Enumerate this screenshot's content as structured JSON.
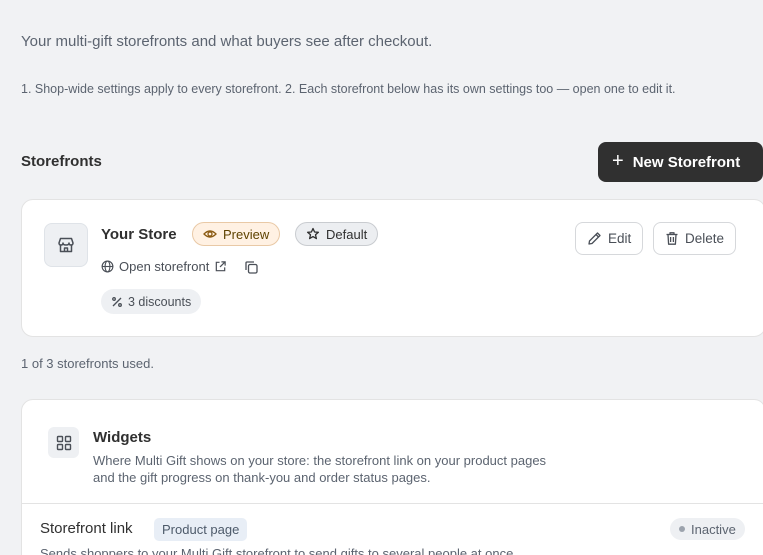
{
  "header": {
    "subtitle": "Your multi-gift storefronts and what buyers see after checkout.",
    "notes": "1. Shop-wide settings apply to every storefront. 2. Each storefront below has its own settings too — open one to edit it."
  },
  "storefronts": {
    "section_title": "Storefronts",
    "new_button_label": "New Storefront",
    "usage": "1 of 3 storefronts used.",
    "store": {
      "name": "Your Store",
      "preview_badge": "Preview",
      "default_badge": "Default",
      "open_link": "Open storefront",
      "discounts": "3 discounts",
      "edit_label": "Edit",
      "delete_label": "Delete",
      "icon": "store-icon"
    }
  },
  "widgets": {
    "title": "Widgets",
    "description": "Where Multi Gift shows on your store: the storefront link on your product pages and the gift progress on thank-you and order status pages.",
    "icon": "grid-icon",
    "items": [
      {
        "title": "Storefront link",
        "tag": "Product page",
        "status": "Inactive",
        "description": "Sends shoppers to your Multi Gift storefront to send gifts to several people at once."
      }
    ]
  },
  "colors": {
    "primary_button": "#303030",
    "preview_badge_bg": "#fff1e3",
    "tag_bg": "#e8eef6"
  }
}
